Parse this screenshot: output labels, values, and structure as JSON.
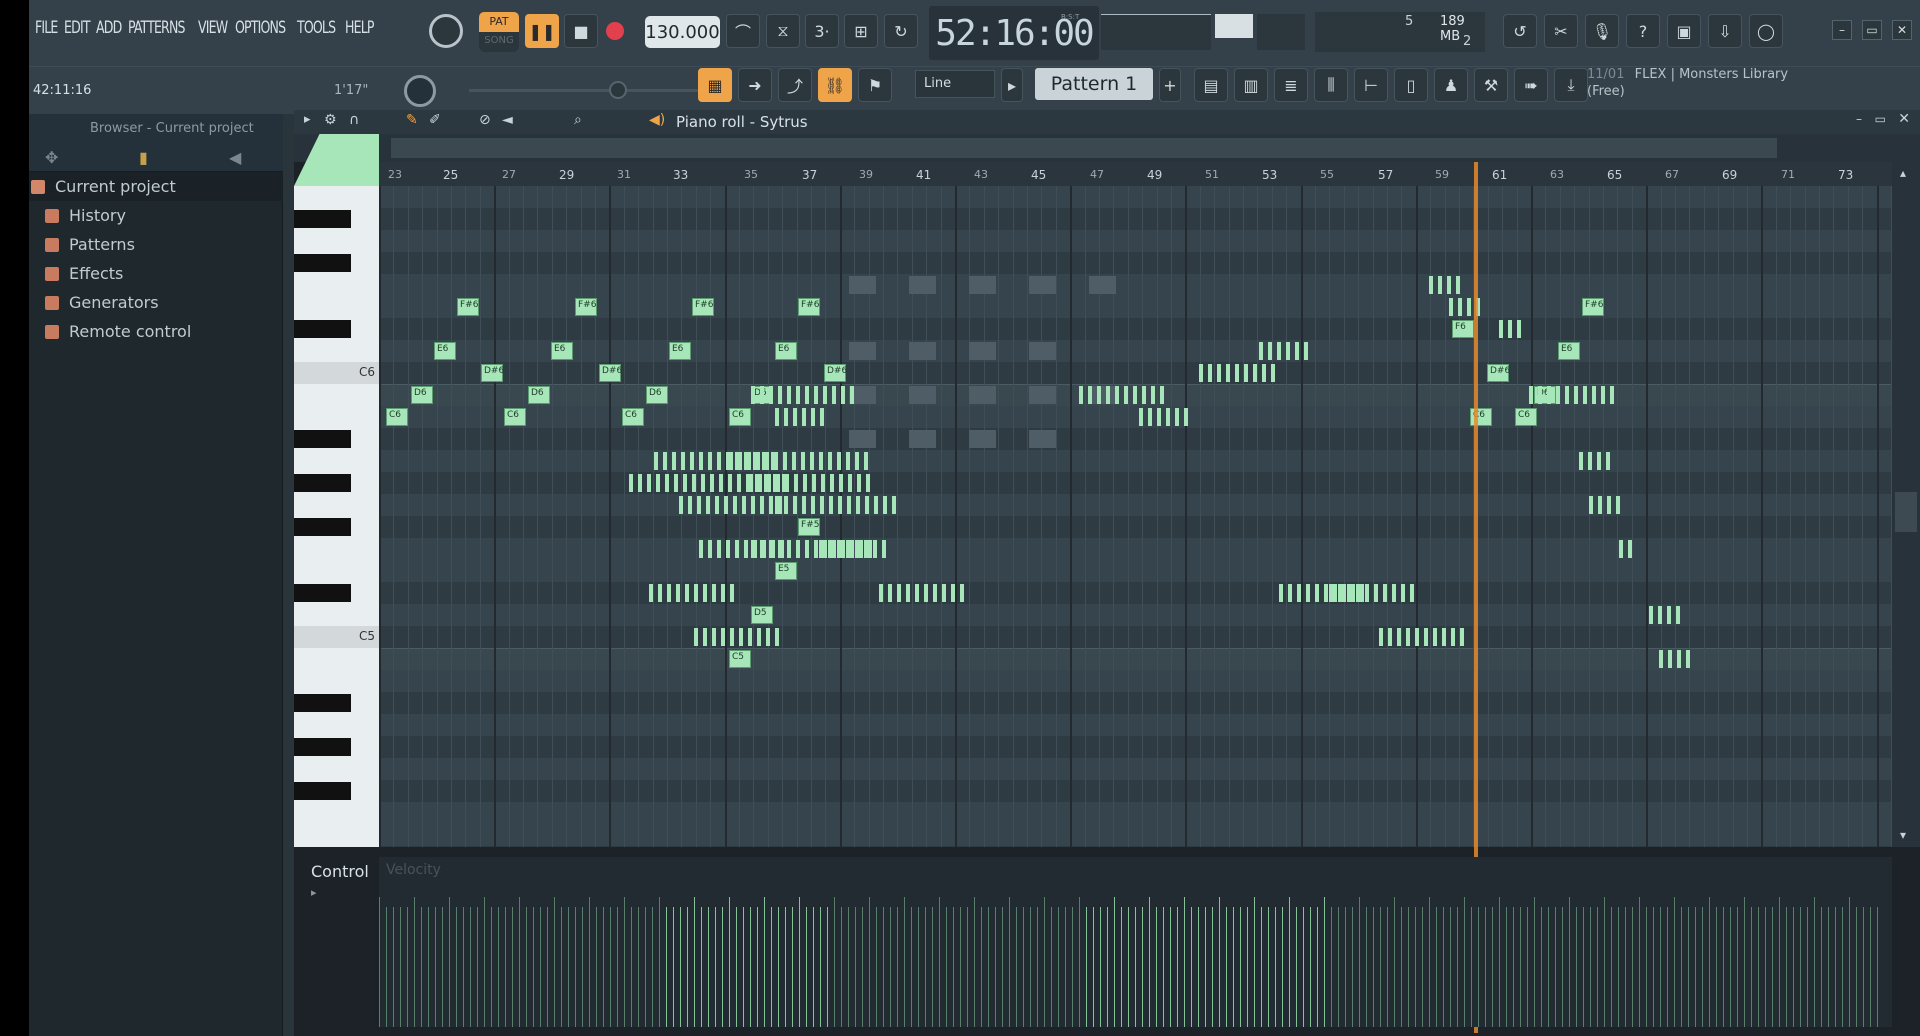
{
  "menu": [
    "FILE",
    "EDIT",
    "ADD",
    "PATTERNS",
    "VIEW",
    "OPTIONS",
    "TOOLS",
    "HELP"
  ],
  "transport": {
    "pat_label": "PAT",
    "song_label": "SONG",
    "bpm": "130.000",
    "time": "52:16:00",
    "time_small": "B:S:T"
  },
  "stats": {
    "cpu": "5",
    "memory": "189 MB",
    "polyphony": "2"
  },
  "row2": {
    "hint_time": "42:11:16",
    "hint_right": "1'17\"",
    "snap": "Line",
    "pattern": "Pattern 1",
    "plugin_counter": "11/01",
    "plugin_name": "FLEX | Monsters Library",
    "plugin_price": "(Free)"
  },
  "browser": {
    "title": "Browser - Current project",
    "root": "Current project",
    "items": [
      "History",
      "Patterns",
      "Effects",
      "Generators",
      "Remote control"
    ]
  },
  "pianoroll": {
    "title": "Piano roll - Sytrus",
    "ruler_major": [
      "25",
      "29",
      "33",
      "37",
      "41",
      "45",
      "49",
      "53",
      "57",
      "61",
      "65",
      "69",
      "73"
    ],
    "ruler_minor": [
      "23",
      "27",
      "31",
      "35",
      "39",
      "43",
      "47",
      "51",
      "55",
      "59",
      "63",
      "67",
      "71"
    ],
    "key_labels": [
      "C6",
      "C5"
    ],
    "notes": [
      "F#6",
      "F#6",
      "F#6",
      "F#6",
      "F#6",
      "F6",
      "E6",
      "E6",
      "E6",
      "E6",
      "E6",
      "D#6",
      "D#6",
      "D#6",
      "D#6",
      "D6",
      "D6",
      "D6",
      "D6",
      "D6",
      "C6",
      "C6",
      "C6",
      "C6",
      "C6",
      "C6",
      "F#5",
      "E5",
      "D5",
      "C5"
    ],
    "control_label": "Control",
    "control_param": "Velocity"
  },
  "colors": {
    "note": "#a7e6b9",
    "playhead": "#e6892c",
    "accent": "#f0a44a"
  }
}
